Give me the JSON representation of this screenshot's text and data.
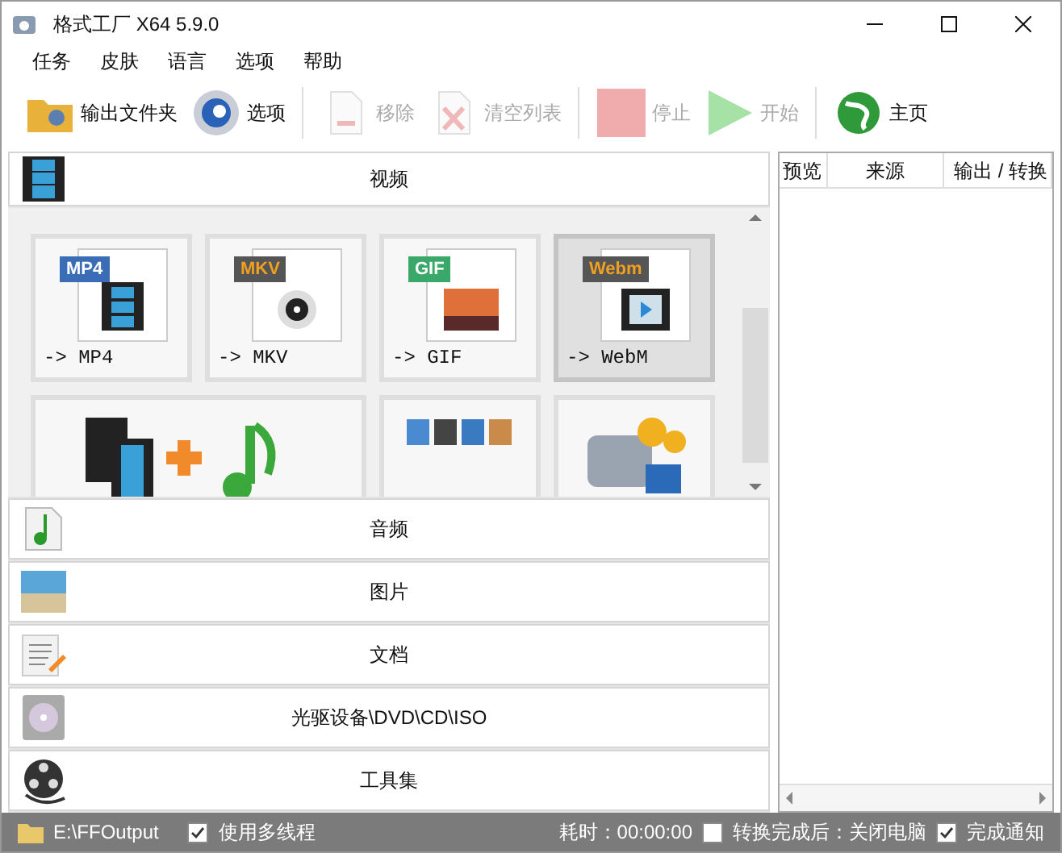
{
  "window": {
    "title": "格式工厂 X64 5.9.0"
  },
  "menu": [
    "任务",
    "皮肤",
    "语言",
    "选项",
    "帮助"
  ],
  "toolbar": [
    {
      "label": "输出文件夹",
      "disabled": false
    },
    {
      "label": "选项",
      "disabled": false
    },
    {
      "label": "移除",
      "disabled": true
    },
    {
      "label": "清空列表",
      "disabled": true
    },
    {
      "label": "停止",
      "disabled": true
    },
    {
      "label": "开始",
      "disabled": true
    },
    {
      "label": "主页",
      "disabled": false
    }
  ],
  "video_section": {
    "title": "视频",
    "tiles": [
      {
        "tag": "MP4",
        "label": "-> MP4",
        "selected": false
      },
      {
        "tag": "MKV",
        "label": "-> MKV",
        "selected": false
      },
      {
        "tag": "GIF",
        "label": "-> GIF",
        "selected": false
      },
      {
        "tag": "Webm",
        "label": "-> WebM",
        "selected": true
      }
    ]
  },
  "sections": [
    {
      "title": "音频"
    },
    {
      "title": "图片"
    },
    {
      "title": "文档"
    },
    {
      "title": "光驱设备\\DVD\\CD\\ISO"
    },
    {
      "title": "工具集"
    }
  ],
  "task_list": {
    "columns": [
      "预览",
      "来源",
      "输出 / 转换"
    ]
  },
  "status_bar": {
    "output_folder": "E:\\FFOutput",
    "multithread": {
      "label": "使用多线程",
      "checked": true
    },
    "elapsed": "耗时：00:00:00",
    "shutdown": {
      "label": "转换完成后：关闭电脑",
      "checked": false
    },
    "notify": {
      "label": "完成通知",
      "checked": true
    }
  }
}
